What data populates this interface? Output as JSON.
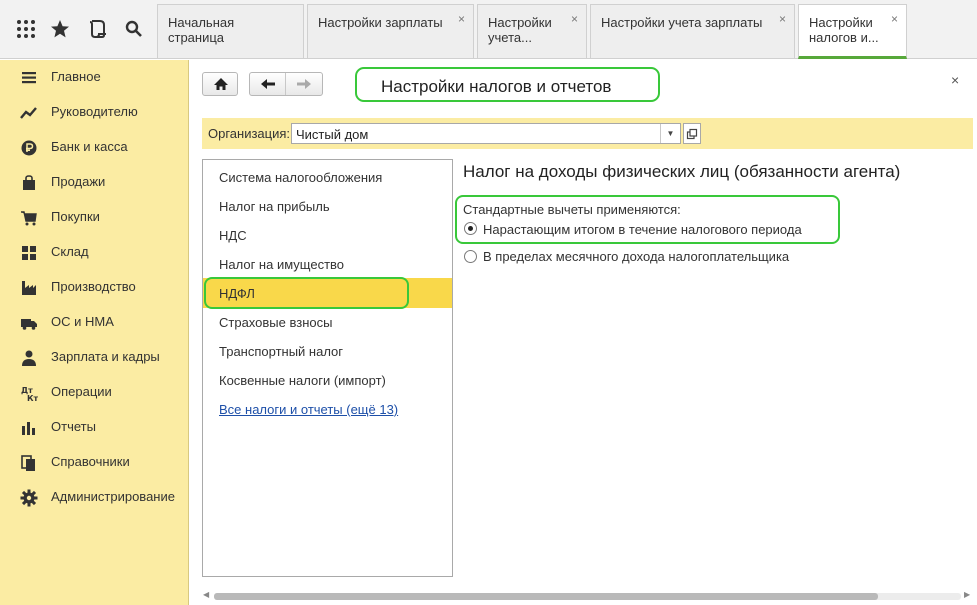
{
  "tabs": [
    {
      "label": "Начальная страница",
      "closable": false,
      "active": false
    },
    {
      "label": "Настройки зарплаты",
      "closable": true,
      "active": false
    },
    {
      "label": "Настройки учета...",
      "closable": true,
      "active": false
    },
    {
      "label": "Настройки учета зарплаты",
      "closable": true,
      "active": false
    },
    {
      "label": "Настройки налогов и...",
      "closable": true,
      "active": true
    }
  ],
  "tab_close_glyph": "×",
  "sidebar": {
    "items": [
      {
        "label": "Главное",
        "icon": "menu-lines-icon"
      },
      {
        "label": "Руководителю",
        "icon": "trend-chart-icon"
      },
      {
        "label": "Банк и касса",
        "icon": "ruble-coin-icon"
      },
      {
        "label": "Продажи",
        "icon": "shopping-bag-icon"
      },
      {
        "label": "Покупки",
        "icon": "cart-icon"
      },
      {
        "label": "Склад",
        "icon": "warehouse-icon"
      },
      {
        "label": "Производство",
        "icon": "factory-icon"
      },
      {
        "label": "ОС и НМА",
        "icon": "truck-icon"
      },
      {
        "label": "Зарплата и кадры",
        "icon": "person-icon"
      },
      {
        "label": "Операции",
        "icon": "dt-kt-icon"
      },
      {
        "label": "Отчеты",
        "icon": "bar-chart-icon"
      },
      {
        "label": "Справочники",
        "icon": "books-icon"
      },
      {
        "label": "Администрирование",
        "icon": "gear-icon"
      }
    ]
  },
  "page": {
    "title": "Настройки налогов и отчетов",
    "close_glyph": "×",
    "org_label": "Организация:",
    "org_value": "Чистый дом"
  },
  "left_list": {
    "items": [
      "Система налогообложения",
      "Налог на прибыль",
      "НДС",
      "Налог на имущество",
      "НДФЛ",
      "Страховые взносы",
      "Транспортный налог",
      "Косвенные налоги (импорт)"
    ],
    "selected_index": 4,
    "link": "Все налоги и отчеты (ещё 13)"
  },
  "right": {
    "heading": "Налог на доходы физических лиц (обязанности агента)",
    "group_label": "Стандартные вычеты применяются:",
    "options": [
      {
        "label": "Нарастающим итогом в течение налогового периода",
        "checked": true
      },
      {
        "label": "В пределах месячного дохода налогоплательщика",
        "checked": false
      }
    ]
  },
  "colors": {
    "sidebar_bg": "#fbeca3",
    "selected_item": "#f9d84a",
    "highlight_border": "#39c83a",
    "link": "#1d4fa8"
  }
}
